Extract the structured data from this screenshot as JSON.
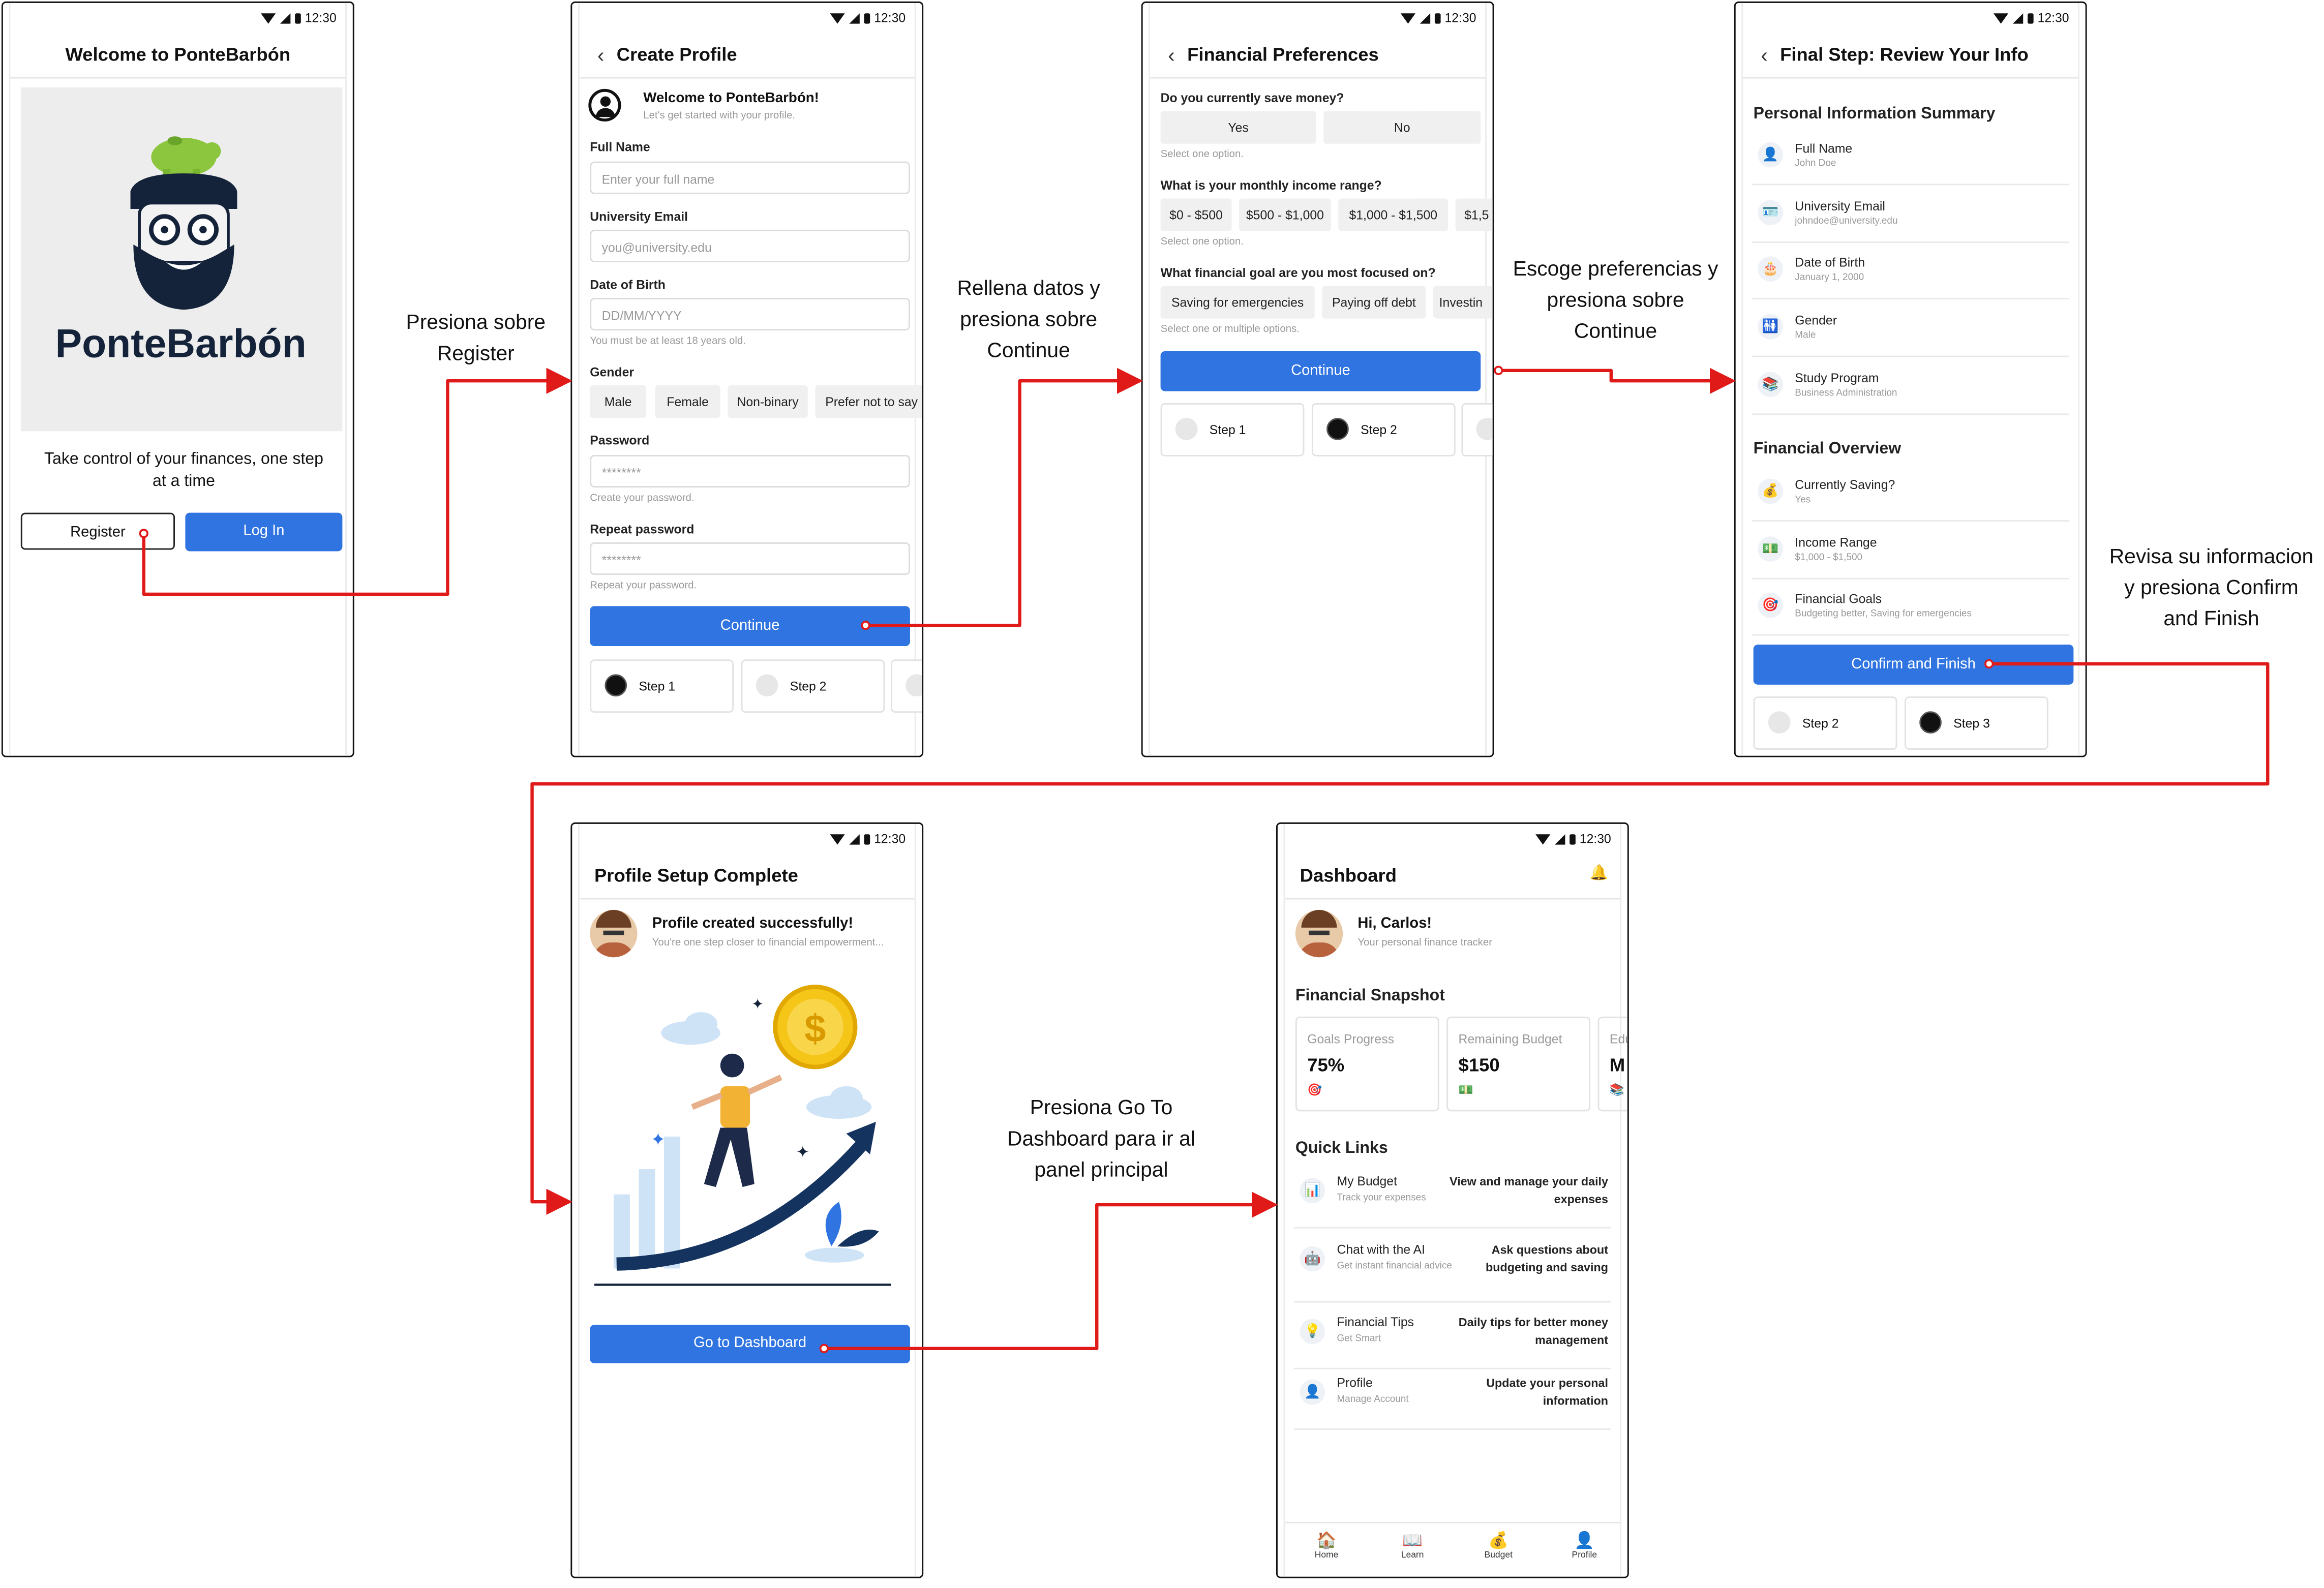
{
  "status_time": "12:30",
  "annotations": {
    "a1": [
      "Presiona sobre",
      "Register"
    ],
    "a2": [
      "Rellena datos y",
      "presiona sobre",
      "Continue"
    ],
    "a3": [
      "Escoge preferencias y",
      "presiona sobre",
      "Continue"
    ],
    "a4": [
      "Revisa su informacion",
      "y presiona Confirm",
      "and Finish"
    ],
    "a5": [
      "Presiona Go To",
      "Dashboard para ir al",
      "panel principal"
    ]
  },
  "welcome": {
    "title": "Welcome to PonteBarbón",
    "logo_text": "PonteBarbón",
    "tagline": "Take control of your finances, one step at a time",
    "register": "Register",
    "login": "Log In"
  },
  "create": {
    "title": "Create Profile",
    "welcome": "Welcome to PonteBarbón!",
    "sub": "Let's get started with your profile.",
    "full_name_label": "Full Name",
    "full_name_ph": "Enter your full name",
    "email_label": "University Email",
    "email_ph": "you@university.edu",
    "dob_label": "Date of Birth",
    "dob_ph": "DD/MM/YYYY",
    "dob_hint": "You must be at least 18 years old.",
    "gender_label": "Gender",
    "genders": [
      "Male",
      "Female",
      "Non-binary",
      "Prefer not to say"
    ],
    "password_label": "Password",
    "password_val": "********",
    "password_hint": "Create your password.",
    "repeat_label": "Repeat password",
    "repeat_val": "********",
    "repeat_hint": "Repeat your password.",
    "continue": "Continue",
    "steps": [
      "Step 1",
      "Step 2"
    ]
  },
  "prefs": {
    "title": "Financial Preferences",
    "q1": "Do you currently save money?",
    "q1_opts": [
      "Yes",
      "No"
    ],
    "q1_hint": "Select one option.",
    "q2": "What is your monthly income range?",
    "q2_opts": [
      "$0 - $500",
      "$500 - $1,000",
      "$1,000 - $1,500",
      "$1,5"
    ],
    "q2_hint": "Select one option.",
    "q3": "What financial goal are you most focused on?",
    "q3_opts": [
      "Saving for emergencies",
      "Paying off debt",
      "Investin"
    ],
    "q3_hint": "Select one or multiple options.",
    "continue": "Continue",
    "steps": [
      "Step 1",
      "Step 2"
    ]
  },
  "review": {
    "title": "Final Step: Review Your Info",
    "personal_title": "Personal Information Summary",
    "personal": [
      {
        "icon": "user-icon",
        "glyph": "👤",
        "label": "Full Name",
        "value": "John Doe"
      },
      {
        "icon": "id-card-icon",
        "glyph": "🪪",
        "label": "University Email",
        "value": "johndoe@university.edu"
      },
      {
        "icon": "cake-icon",
        "glyph": "🎂",
        "label": "Date of Birth",
        "value": "January 1, 2000"
      },
      {
        "icon": "gender-icon",
        "glyph": "🚻",
        "label": "Gender",
        "value": "Male"
      },
      {
        "icon": "books-icon",
        "glyph": "📚",
        "label": "Study Program",
        "value": "Business Administration"
      }
    ],
    "financial_title": "Financial Overview",
    "financial": [
      {
        "icon": "money-bag-icon",
        "glyph": "💰",
        "label": "Currently Saving?",
        "value": "Yes"
      },
      {
        "icon": "cash-icon",
        "glyph": "💵",
        "label": "Income Range",
        "value": "$1,000 - $1,500"
      },
      {
        "icon": "target-icon",
        "glyph": "🎯",
        "label": "Financial Goals",
        "value": "Budgeting better, Saving for emergencies"
      }
    ],
    "confirm": "Confirm and Finish",
    "steps": [
      "Step 2",
      "Step 3"
    ]
  },
  "complete": {
    "title": "Profile Setup Complete",
    "msg": "Profile created successfully!",
    "sub": "You're one step closer to financial empowerment...",
    "button": "Go to Dashboard"
  },
  "dashboard": {
    "title": "Dashboard",
    "greeting": "Hi, Carlos!",
    "sub": "Your personal finance tracker",
    "snapshot_title": "Financial Snapshot",
    "cards": [
      {
        "label": "Goals Progress",
        "value": "75%",
        "glyph": "🎯"
      },
      {
        "label": "Remaining Budget",
        "value": "$150",
        "glyph": "💵"
      },
      {
        "label": "Edu",
        "value": "M",
        "glyph": "📚"
      }
    ],
    "quick_title": "Quick Links",
    "links": [
      {
        "icon": "chart-icon",
        "glyph": "📊",
        "label": "My Budget",
        "sub": "Track your expenses",
        "desc": "View and manage your daily expenses"
      },
      {
        "icon": "robot-icon",
        "glyph": "🤖",
        "label": "Chat with the AI",
        "sub": "Get instant financial advice",
        "desc": "Ask questions about budgeting and saving"
      },
      {
        "icon": "bulb-icon",
        "glyph": "💡",
        "label": "Financial Tips",
        "sub": "Get Smart",
        "desc": "Daily tips for better money management"
      },
      {
        "icon": "user-icon",
        "glyph": "👤",
        "label": "Profile",
        "sub": "Manage Account",
        "desc": "Update your personal information"
      }
    ],
    "nav": [
      {
        "icon": "home-icon",
        "glyph": "🏠",
        "label": "Home"
      },
      {
        "icon": "book-icon",
        "glyph": "📖",
        "label": "Learn"
      },
      {
        "icon": "money-bag-icon",
        "glyph": "💰",
        "label": "Budget"
      },
      {
        "icon": "profile-icon",
        "glyph": "👤",
        "label": "Profile"
      }
    ]
  },
  "colors": {
    "primary": "#2f74e0",
    "arrow": "#e01919"
  }
}
